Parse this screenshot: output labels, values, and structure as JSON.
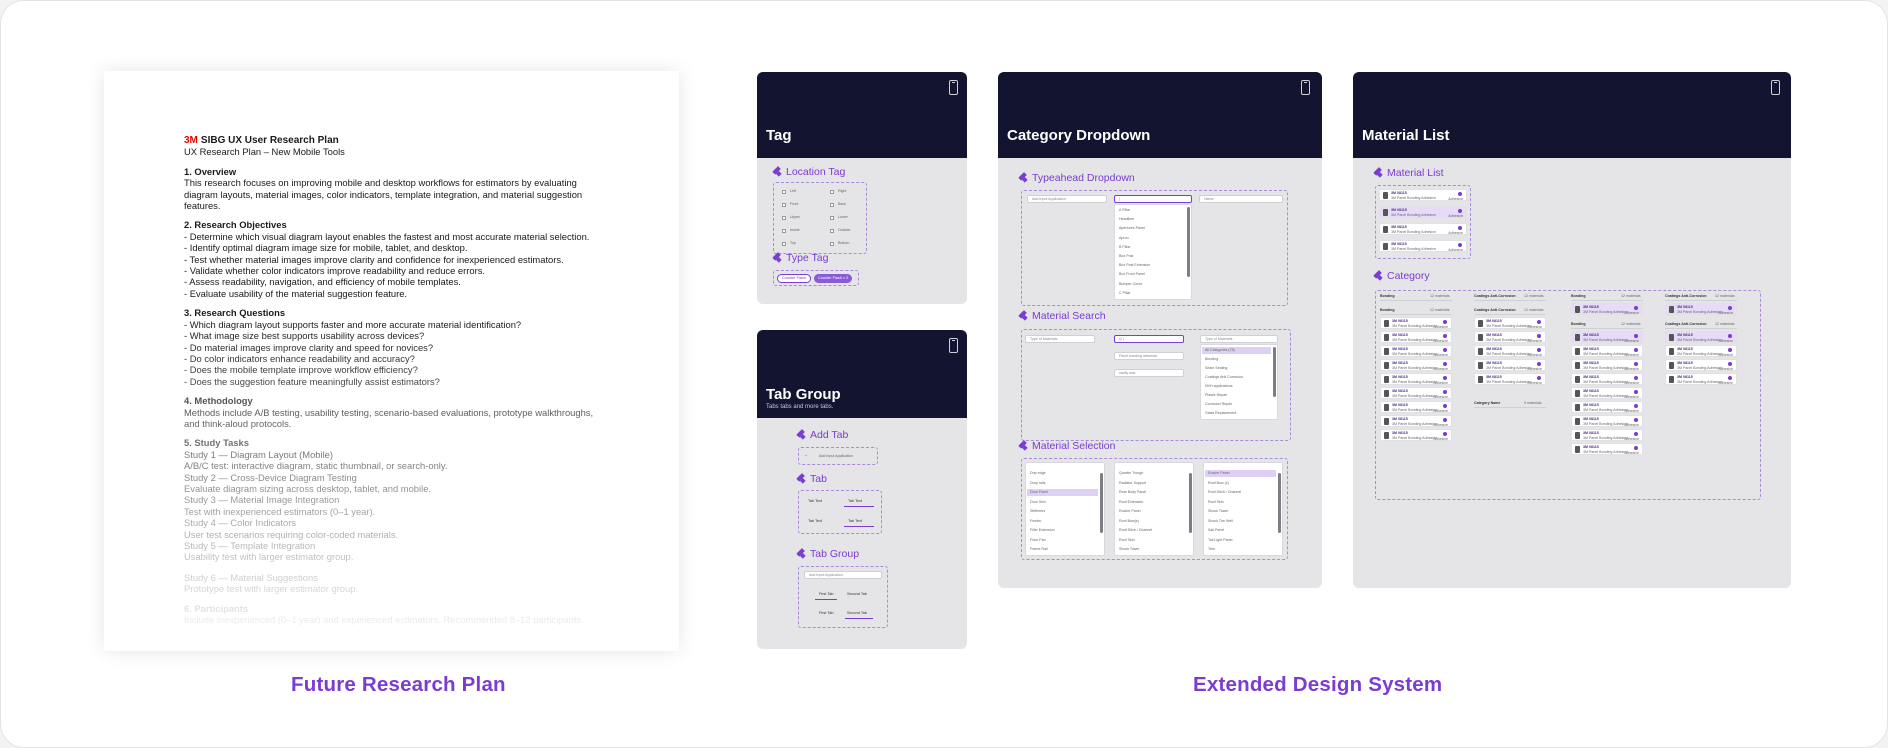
{
  "colors": {
    "accent": "#7a3cd1",
    "card_header": "#121430",
    "card_bg": "#e5e5e7",
    "logo_red": "#e10600"
  },
  "document": {
    "logo": "3M",
    "title": "SIBG UX User Research Plan",
    "subtitle": "UX Research Plan – New Mobile Tools",
    "sections": [
      {
        "heading": "1. Overview",
        "lines": [
          "This research focuses on improving mobile and desktop workflows for estimators by evaluating diagram layouts, material images, color indicators, template integration, and material suggestion features."
        ]
      },
      {
        "heading": "2. Research Objectives",
        "lines": [
          "- Determine which visual diagram layout enables the fastest and most accurate material selection.",
          "- Identify optimal diagram image size for mobile, tablet, and desktop.",
          "- Test whether material images improve clarity and confidence for inexperienced estimators.",
          "- Validate whether color indicators improve readability and reduce errors.",
          "- Assess readability, navigation, and efficiency of mobile templates.",
          "- Evaluate usability of the material suggestion feature."
        ]
      },
      {
        "heading": "3. Research Questions",
        "lines": [
          "- Which diagram layout supports faster and more accurate material identification?",
          "- What image size best supports usability across devices?",
          "- Do material images improve clarity and speed for novices?",
          "- Do color indicators enhance readability and accuracy?",
          "- Does the mobile template improve workflow efficiency?",
          "- Does the suggestion feature meaningfully assist estimators?"
        ]
      },
      {
        "heading": "4. Methodology",
        "lines": [
          "Methods include A/B testing, usability testing, scenario-based evaluations, prototype walkthroughs, and think-aloud protocols."
        ]
      },
      {
        "heading": "5. Study Tasks",
        "lines": [
          "Study 1 — Diagram Layout (Mobile)",
          "A/B/C test: interactive diagram, static thumbnail, or search-only.",
          "Study 2 — Cross-Device Diagram Testing",
          "Evaluate diagram sizing across desktop, tablet, and mobile.",
          "Study 3 — Material Image Integration",
          "Test with inexperienced estimators (0–1 year).",
          "Study 4 — Color Indicators",
          "User test scenarios requiring color-coded materials.",
          "Study 5 — Template Integration",
          "Usability test with larger estimator group.",
          "",
          "Study 6 — Material Suggestions",
          "Prototype test with larger estimator group."
        ]
      },
      {
        "heading": "6. Participants",
        "lines": [
          "Include inexperienced (0–1 year) and experienced estimators. Recommended 8–12 participants"
        ]
      }
    ]
  },
  "captions": {
    "left": "Future Research Plan",
    "right": "Extended Design System"
  },
  "tag_card": {
    "title": "Tag",
    "location_tag": "Location Tag",
    "type_tag": "Type Tag",
    "checkbox_labels": [
      "Left",
      "Right",
      "Front",
      "Back",
      "Upper",
      "Lower",
      "Inside",
      "Outside",
      "Top",
      "Bottom"
    ],
    "chip_outline": "Counter Flash",
    "chip_filled": "Counter Flash × 2"
  },
  "tab_card": {
    "title": "Tab Group",
    "subtitle": "Tabs tabs and more tabs.",
    "add_tab": "Add Tab",
    "tab": "Tab",
    "tab_group": "Tab Group",
    "add_field": "Add Input Application",
    "tab_text": "Tab Text",
    "first_tab": "First Tab",
    "second_tab": "Second Tab"
  },
  "category_card": {
    "title": "Category Dropdown",
    "typeahead": "Typeahead Dropdown",
    "material_search": "Material Search",
    "material_selection": "Material Selection",
    "placeholder_app": "Add Input Application",
    "field_name": "Name",
    "typeahead_options": [
      "A Pillar",
      "Headliner",
      "Apertures Panel",
      "Apron",
      "B Pillar",
      "Box Post",
      "Box Post Extension",
      "Box Front Panel",
      "Bumper Cover",
      "C Pillar"
    ],
    "search_placeholder": "Type of Materials",
    "search_filter_1": "Panel bonding adhesive",
    "search_filter_2": "cavity wax",
    "search_results": [
      "All Categories (78)",
      "Bonding",
      "Seam Sealing",
      "Coatings Anti Corrosion",
      "NVH applications",
      "Plastic Repair",
      "Corrosion Repair",
      "Glass Replacement"
    ],
    "sel_col1": [
      "Drip edge",
      "Drop rails",
      "Door Panel",
      "Door Skin",
      "Stiffeners",
      "Fender",
      "Filler Extension",
      "Floor Pan",
      "Frame Rail"
    ],
    "sel_col2": [
      "Quarter Trough",
      "Radiator Support",
      "Rear Body Panel",
      "Roof Extension",
      "Rocker Panel",
      "Roof Bow(s)",
      "Roof Ditch / Channel",
      "Roof Skin",
      "Shock Tower"
    ],
    "sel_col3": [
      "Rocker Panel",
      "Roof Bow (s)",
      "Roof Ditch / Channel",
      "Roof Skin",
      "Shock Tower",
      "Shock Tire Well",
      "Sail Panel",
      "Tail Light Panel",
      "Trim"
    ]
  },
  "material_card": {
    "title": "Material List",
    "material_list": "Material List",
    "category": "Category",
    "group_bonding": "Bonding",
    "group_coatings": "Coatings Anti-Corrosion",
    "group_count": "12 materials",
    "group_name": "Category Name",
    "group_empty": "0 materials",
    "item_code": "3M 08115",
    "item_name": "3M Panel Bonding Adhesive",
    "item_tag": "Adhesive"
  }
}
